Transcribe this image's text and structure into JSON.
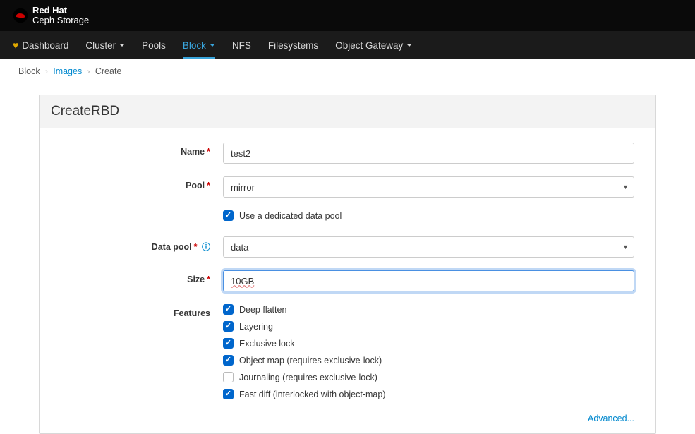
{
  "brand": {
    "line1": "Red Hat",
    "line2": "Ceph Storage"
  },
  "nav": {
    "items": [
      {
        "label": "Dashboard",
        "hasCaret": false,
        "active": false,
        "icon": "heart"
      },
      {
        "label": "Cluster",
        "hasCaret": true,
        "active": false
      },
      {
        "label": "Pools",
        "hasCaret": false,
        "active": false
      },
      {
        "label": "Block",
        "hasCaret": true,
        "active": true
      },
      {
        "label": "NFS",
        "hasCaret": false,
        "active": false
      },
      {
        "label": "Filesystems",
        "hasCaret": false,
        "active": false
      },
      {
        "label": "Object Gateway",
        "hasCaret": true,
        "active": false
      }
    ]
  },
  "breadcrumb": {
    "item0": "Block",
    "item1": "Images",
    "item2": "Create"
  },
  "card": {
    "title": "CreateRBD"
  },
  "form": {
    "name": {
      "label": "Name",
      "value": "test2"
    },
    "pool": {
      "label": "Pool",
      "value": "mirror"
    },
    "dedicated": {
      "label": "Use a dedicated data pool",
      "checked": true
    },
    "datapool": {
      "label": "Data pool",
      "value": "data"
    },
    "size": {
      "label": "Size",
      "value": "10GB"
    },
    "features": {
      "label": "Features",
      "items": [
        {
          "label": "Deep flatten",
          "checked": true
        },
        {
          "label": "Layering",
          "checked": true
        },
        {
          "label": "Exclusive lock",
          "checked": true
        },
        {
          "label": "Object map (requires exclusive-lock)",
          "checked": true
        },
        {
          "label": "Journaling (requires exclusive-lock)",
          "checked": false
        },
        {
          "label": "Fast diff (interlocked with object-map)",
          "checked": true
        }
      ]
    },
    "advanced": "Advanced..."
  }
}
